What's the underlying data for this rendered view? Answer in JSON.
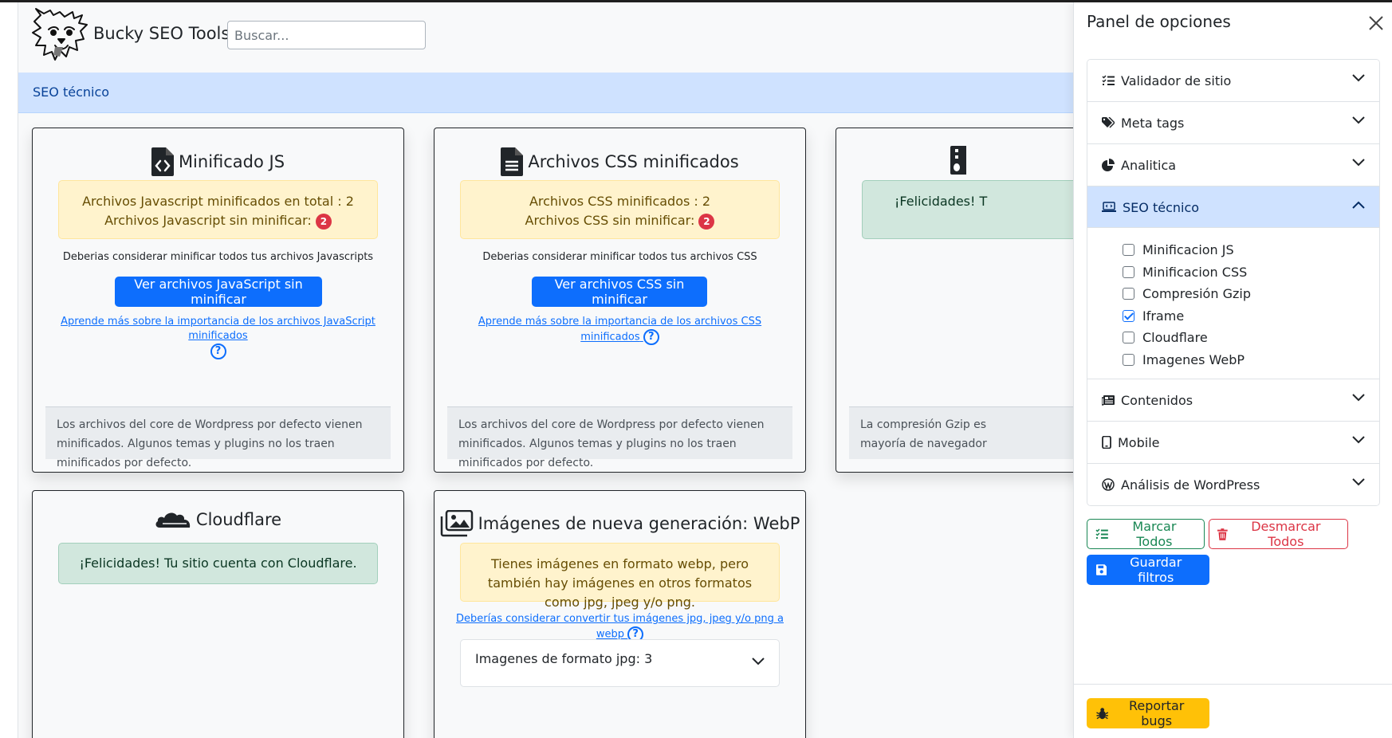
{
  "app": {
    "brand": "Bucky SEO Tools"
  },
  "search": {
    "placeholder": "Buscar..."
  },
  "section": {
    "title": "SEO técnico"
  },
  "cards": {
    "js": {
      "title": "Minificado JS",
      "alert_line1": "Archivos Javascript minificados en total : 2",
      "alert_line2": "Archivos Javascript sin minificar:",
      "badge": "2",
      "hint": "Deberias considerar minificar todos tus archivos Javascripts",
      "button": "Ver archivos JavaScript sin minificar",
      "learn": "Aprende más sobre la importancia de los archivos JavaScript minificados",
      "qmark": "?",
      "footer": "Los archivos del core de Wordpress por defecto vienen minificados. Algunos temas y plugins no los traen minificados por defecto."
    },
    "css": {
      "title": "Archivos CSS minificados",
      "alert_line1": "Archivos CSS minificados : 2",
      "alert_line2": "Archivos CSS sin minificar:",
      "badge": "2",
      "hint": "Deberias considerar minificar todos tus archivos CSS",
      "button": "Ver archivos CSS sin minificar",
      "learn": "Aprende más sobre la importancia de los archivos CSS minificados",
      "qmark": "?",
      "footer": "Los archivos del core de Wordpress por defecto vienen minificados. Algunos temas y plugins no los traen minificados por defecto."
    },
    "gzip": {
      "alert": "¡Felicidades! T",
      "footer_line1": "La compresión Gzip es",
      "footer_line2": "mayoría de navegador"
    },
    "cloudflare": {
      "title": "Cloudflare",
      "alert": "¡Felicidades! Tu sitio cuenta con Cloudflare."
    },
    "webp": {
      "title": "Imágenes de nueva generación: WebP",
      "alert": "Tienes imágenes en formato webp, pero también hay imágenes en otros formatos como jpg, jpeg y/o png.",
      "learn": "Deberías considerar convertir tus imágenes jpg, jpeg y/o png a webp",
      "qmark": "?",
      "accordion": "Imagenes de formato jpg: 3"
    }
  },
  "panel": {
    "title": "Panel de opciones",
    "close_label": "×",
    "sections": [
      {
        "label": "Validador de sitio",
        "icon": "list-check-icon",
        "expanded": false
      },
      {
        "label": "Meta tags",
        "icon": "tags-icon",
        "expanded": false
      },
      {
        "label": "Analitica",
        "icon": "pie-chart-icon",
        "expanded": false
      },
      {
        "label": "SEO técnico",
        "icon": "laptop-code-icon",
        "expanded": true
      },
      {
        "label": "Contenidos",
        "icon": "newspaper-icon",
        "expanded": false
      },
      {
        "label": "Mobile",
        "icon": "mobile-icon",
        "expanded": false
      },
      {
        "label": "Análisis de WordPress",
        "icon": "wordpress-icon",
        "expanded": false
      }
    ],
    "checks": [
      {
        "label": "Minificacion JS",
        "checked": false
      },
      {
        "label": "Minificacion CSS",
        "checked": false
      },
      {
        "label": "Compresión Gzip",
        "checked": false
      },
      {
        "label": "Iframe",
        "checked": true
      },
      {
        "label": "Cloudflare",
        "checked": false
      },
      {
        "label": "Imagenes WebP",
        "checked": false
      }
    ],
    "mark_all": "Marcar Todos",
    "unmark_all": "Desmarcar Todos",
    "save": "Guardar filtros",
    "report": "Reportar bugs"
  },
  "colors": {
    "primary": "#0d6efd",
    "success": "#198754",
    "danger": "#dc3545",
    "warning": "#ffc107",
    "section_bg": "#cfe2ff"
  }
}
